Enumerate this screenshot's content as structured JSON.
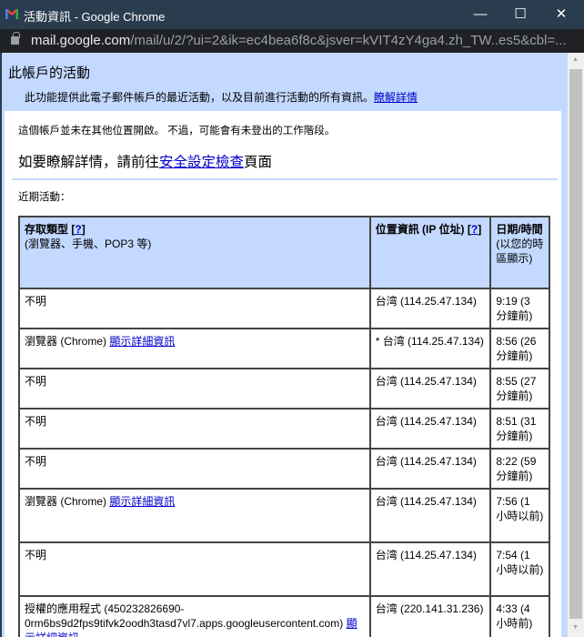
{
  "window": {
    "title": "活動資訊 - Google Chrome",
    "minimize": "—",
    "maximize": "☐",
    "close": "✕"
  },
  "address": {
    "host": "mail.google.com",
    "path": "/mail/u/2/?ui=2&ik=ec4bea6f8c&jsver=kVIT4zY4ga4.zh_TW..es5&cbl=..."
  },
  "header": {
    "title": "此帳戶的活動",
    "description": "此功能提供此電子郵件帳戶的最近活動，以及目前進行活動的所有資訊。",
    "learn_more": "瞭解詳情"
  },
  "body": {
    "note": "這個帳戶並未在其他位置開啟。 不過，可能會有未登出的工作階段。",
    "more_prefix": "如要瞭解詳情，請前往",
    "more_link": "安全設定檢查",
    "more_suffix": "頁面",
    "recent": "近期活動："
  },
  "table": {
    "headers": {
      "access": "存取類型",
      "access_help": "?",
      "access_sub": "(瀏覽器、手機、POP3 等)",
      "location": "位置資訊 (IP 位址)",
      "location_help": "?",
      "time": "日期/時間",
      "time_sub": "(以您的時區顯示)"
    },
    "rows": [
      {
        "type": "不明",
        "details": "",
        "location": "台湾 (114.25.47.134)",
        "time": "9:19 (3 分鐘前)"
      },
      {
        "type": "瀏覽器 (Chrome) ",
        "details": "顯示詳細資訊",
        "location": "* 台湾 (114.25.47.134)",
        "time": "8:56 (26 分鐘前)"
      },
      {
        "type": "不明",
        "details": "",
        "location": "台湾 (114.25.47.134)",
        "time": "8:55 (27 分鐘前)"
      },
      {
        "type": "不明",
        "details": "",
        "location": "台湾 (114.25.47.134)",
        "time": "8:51 (31 分鐘前)"
      },
      {
        "type": "不明",
        "details": "",
        "location": "台湾 (114.25.47.134)",
        "time": "8:22 (59 分鐘前)"
      },
      {
        "type": "瀏覽器 (Chrome) ",
        "details": "顯示詳細資訊",
        "location": "台湾 (114.25.47.134)",
        "time": "7:56 (1 小時以前)"
      },
      {
        "type": "不明",
        "details": "",
        "location": "台湾 (114.25.47.134)",
        "time": "7:54 (1 小時以前)"
      },
      {
        "type": "授權的應用程式 (450232826690-0rm6bs9d2fps9tifvk2oodh3tasd7vl7.apps.googleusercontent.com) ",
        "details": "顯示詳細資訊",
        "location": "台湾 (220.141.31.236)",
        "time": "4:33 (4 小時前)"
      }
    ]
  }
}
